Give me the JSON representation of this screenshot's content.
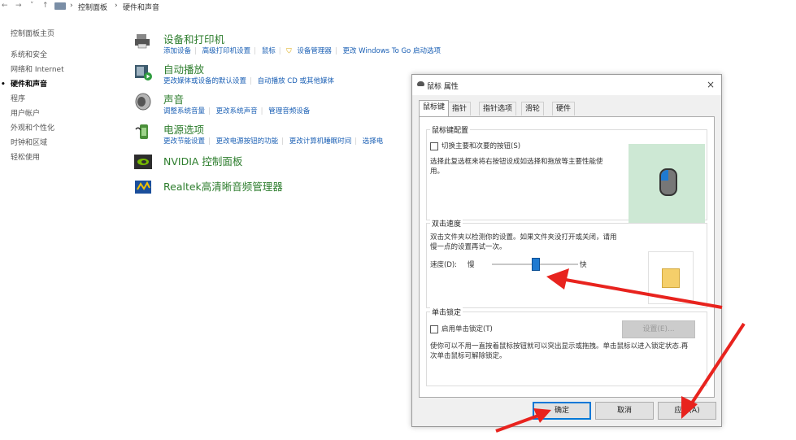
{
  "breadcrumb": {
    "items": [
      "控制面板",
      "硬件和声音"
    ]
  },
  "leftnav": {
    "items": [
      "控制面板主页",
      "系统和安全",
      "网络和 Internet",
      "硬件和声音",
      "程序",
      "用户帐户",
      "外观和个性化",
      "时钟和区域",
      "轻松使用"
    ],
    "active_index": 3
  },
  "categories": [
    {
      "title": "设备和打印机",
      "links": [
        "添加设备",
        "高级打印机设置",
        "鼠标",
        "设备管理器",
        "更改 Windows To Go 启动选项"
      ],
      "icon": "printer-icon"
    },
    {
      "title": "自动播放",
      "links": [
        "更改媒体或设备的默认设置",
        "自动播放 CD 或其他媒体"
      ],
      "icon": "autoplay-icon"
    },
    {
      "title": "声音",
      "links": [
        "调整系统音量",
        "更改系统声音",
        "管理音频设备"
      ],
      "icon": "speaker-icon"
    },
    {
      "title": "电源选项",
      "links": [
        "更改节能设置",
        "更改电源按钮的功能",
        "更改计算机睡眠时间",
        "选择电"
      ],
      "icon": "power-icon"
    },
    {
      "title": "NVIDIA 控制面板",
      "links": [],
      "icon": "nvidia-icon"
    },
    {
      "title": "Realtek高清晰音频管理器",
      "links": [],
      "icon": "realtek-icon"
    }
  ],
  "dialog": {
    "title": "鼠标 属性",
    "close": "×",
    "tabs": [
      "鼠标键",
      "指针",
      "指针选项",
      "滑轮",
      "硬件"
    ],
    "selected_tab": 0,
    "button_config": {
      "label": "鼠标键配置",
      "checkbox_label": "切换主要和次要的按钮(S)",
      "checked": false,
      "description": "选择此复选框来将右按钮设成如选择和拖放等主要性能使用。"
    },
    "double_click": {
      "label": "双击速度",
      "description": "双击文件夹以检测你的设置。如果文件夹没打开或关闭，请用慢一点的设置再试一次。",
      "speed_label": "速度(D):",
      "slow": "慢",
      "fast": "快",
      "speed_fraction": 0.5
    },
    "click_lock": {
      "label": "单击锁定",
      "checkbox_label": "启用单击锁定(T)",
      "checked": false,
      "settings_button": "设置(E)...",
      "description": "使你可以不用一直按着鼠标按钮就可以突出显示或拖拽。单击鼠标以进入锁定状态.再次单击鼠标可解除锁定。"
    },
    "buttons": {
      "ok": "确定",
      "cancel": "取消",
      "apply": "应用(A)"
    }
  },
  "colors": {
    "category_title": "#2d7d2d",
    "link": "#1a5fb4",
    "annotation_arrow": "#e8231e",
    "preview_bg": "#cde8d4"
  }
}
